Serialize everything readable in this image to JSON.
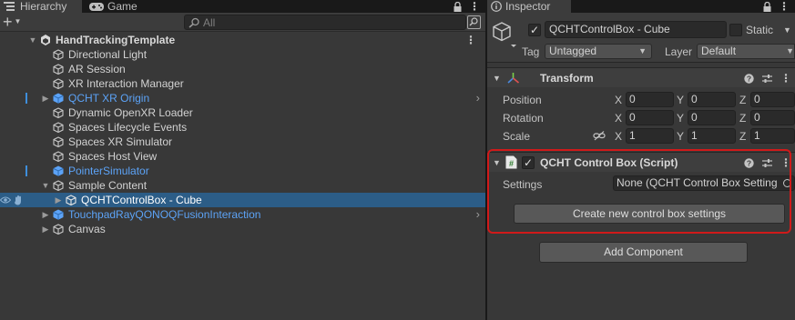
{
  "hierarchy": {
    "tab_label": "Hierarchy",
    "game_tab_label": "Game",
    "add_label": "+",
    "search_placeholder": "All",
    "rows": [
      {
        "label": "HandTrackingTemplate"
      },
      {
        "label": "Directional Light"
      },
      {
        "label": "AR Session"
      },
      {
        "label": "XR Interaction Manager"
      },
      {
        "label": "QCHT XR Origin"
      },
      {
        "label": "Dynamic OpenXR Loader"
      },
      {
        "label": "Spaces Lifecycle Events"
      },
      {
        "label": "Spaces XR Simulator"
      },
      {
        "label": "Spaces Host View"
      },
      {
        "label": "PointerSimulator"
      },
      {
        "label": "Sample Content"
      },
      {
        "label": "QCHTControlBox - Cube"
      },
      {
        "label": "TouchpadRayQONOQFusionInteraction"
      },
      {
        "label": "Canvas"
      }
    ]
  },
  "inspector": {
    "tab_label": "Inspector",
    "object_name": "QCHTControlBox - Cube",
    "static_label": "Static",
    "tag_label": "Tag",
    "tag_value": "Untagged",
    "layer_label": "Layer",
    "layer_value": "Default",
    "transform": {
      "title": "Transform",
      "position_label": "Position",
      "rotation_label": "Rotation",
      "scale_label": "Scale",
      "x": "X",
      "y": "Y",
      "z": "Z",
      "position": [
        "0",
        "0",
        "0"
      ],
      "rotation": [
        "0",
        "0",
        "0"
      ],
      "scale": [
        "1",
        "1",
        "1"
      ]
    },
    "script": {
      "title": "QCHT Control Box (Script)",
      "settings_label": "Settings",
      "settings_value": "None (QCHT Control Box Setting",
      "create_button": "Create new control box settings"
    },
    "add_component_button": "Add Component"
  },
  "colors": {
    "selection": "#2c5d87",
    "prefab_blue": "#5ca3f7",
    "highlight_red": "#d01a1a"
  }
}
